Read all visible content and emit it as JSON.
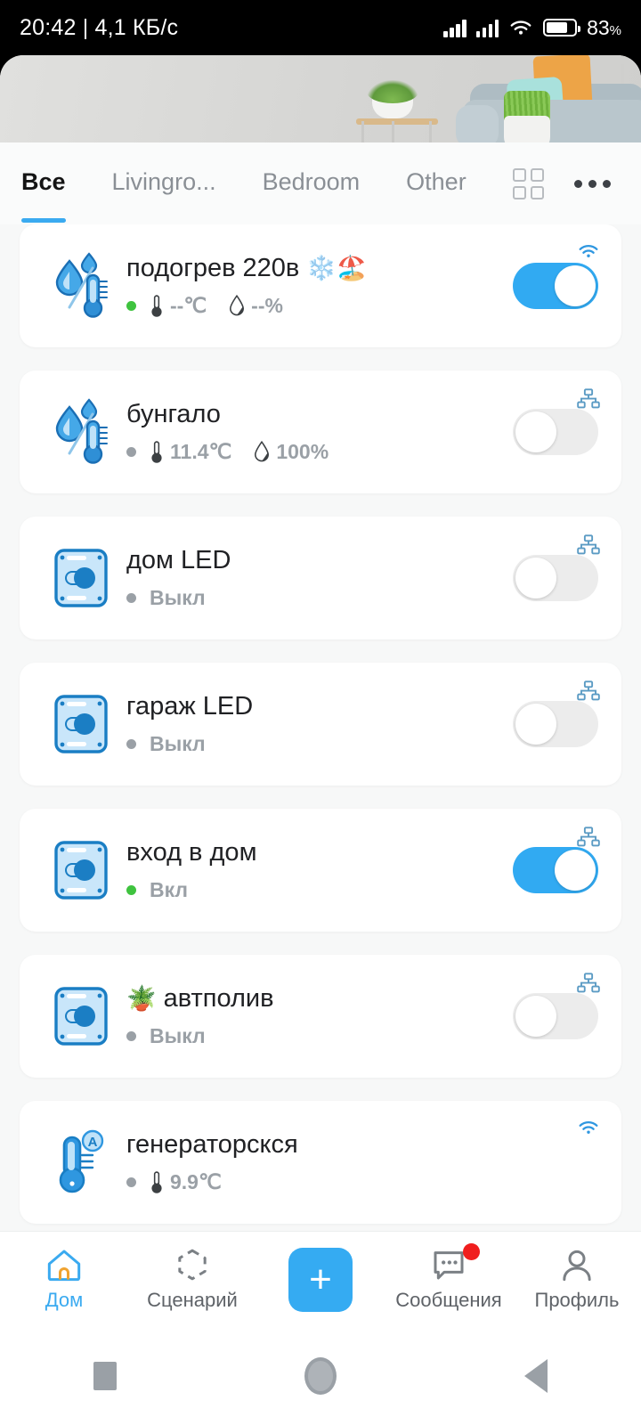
{
  "statusbar": {
    "time_and_traffic": "20:42 | 4,1 КБ/с",
    "battery_percent": "83",
    "percent_sign": "%",
    "signal_icon": "cellular-signal-icon",
    "wifi_icon": "wifi-icon",
    "battery_icon": "battery-icon"
  },
  "tabs": {
    "items": [
      {
        "label": "Все",
        "active": true
      },
      {
        "label": "Livingro...",
        "active": false
      },
      {
        "label": "Bedroom",
        "active": false
      },
      {
        "label": "Other",
        "active": false
      }
    ],
    "grid_icon": "grid-view-icon",
    "more_icon": "more-options-icon"
  },
  "devices": [
    {
      "name": "подогрев 220в",
      "name_emoji": "❄️🏖️",
      "icon": "humidity-temperature-sensor-icon",
      "online": true,
      "temperature": "--℃",
      "humidity": "--%",
      "status_text": "",
      "connection": "wifi-icon",
      "toggle": "on",
      "has_toggle": true
    },
    {
      "name": "бунгало",
      "name_emoji": "",
      "icon": "humidity-temperature-sensor-icon",
      "online": false,
      "temperature": "11.4℃",
      "humidity": "100%",
      "status_text": "",
      "connection": "lan-network-icon",
      "toggle": "off",
      "has_toggle": true
    },
    {
      "name": "дом LED",
      "name_emoji": "",
      "icon": "relay-switch-icon",
      "online": false,
      "temperature": "",
      "humidity": "",
      "status_text": "Выкл",
      "connection": "lan-network-icon",
      "toggle": "off",
      "has_toggle": true
    },
    {
      "name": "гараж LED",
      "name_emoji": "",
      "icon": "relay-switch-icon",
      "online": false,
      "temperature": "",
      "humidity": "",
      "status_text": "Выкл",
      "connection": "lan-network-icon",
      "toggle": "off",
      "has_toggle": true
    },
    {
      "name": "вход в дом",
      "name_emoji": "",
      "icon": "relay-switch-icon",
      "online": true,
      "temperature": "",
      "humidity": "",
      "status_text": "Вкл",
      "connection": "lan-network-icon",
      "toggle": "on",
      "has_toggle": true
    },
    {
      "name": "автполив",
      "name_emoji": "🪴",
      "emoji_before": true,
      "icon": "relay-switch-icon",
      "online": false,
      "temperature": "",
      "humidity": "",
      "status_text": "Выкл",
      "connection": "lan-network-icon",
      "toggle": "off",
      "has_toggle": true
    },
    {
      "name": "генераторскся",
      "name_emoji": "",
      "icon": "thermometer-auto-icon",
      "online": false,
      "temperature": "9.9℃",
      "humidity": "",
      "status_text": "",
      "connection": "wifi-icon",
      "toggle": "off",
      "has_toggle": false
    }
  ],
  "bottomnav": {
    "items": [
      {
        "label": "Дом",
        "icon": "home-icon",
        "active": true,
        "badge": false
      },
      {
        "label": "Сценарий",
        "icon": "scene-icon",
        "active": false,
        "badge": false
      },
      {
        "label": "",
        "icon": "add-device-plus-icon",
        "active": false,
        "badge": false,
        "fab": true,
        "fab_label": "+"
      },
      {
        "label": "Сообщения",
        "icon": "messages-icon",
        "active": false,
        "badge": true
      },
      {
        "label": "Профиль",
        "icon": "profile-icon",
        "active": false,
        "badge": false
      }
    ]
  },
  "sysnav": {
    "recents_icon": "recents-square-icon",
    "home_icon": "home-circle-icon",
    "back_icon": "back-triangle-icon"
  },
  "colors": {
    "accent": "#35abf2",
    "online": "#3fc33f",
    "offline": "#9aa0a6",
    "badge": "#f01e1e"
  }
}
